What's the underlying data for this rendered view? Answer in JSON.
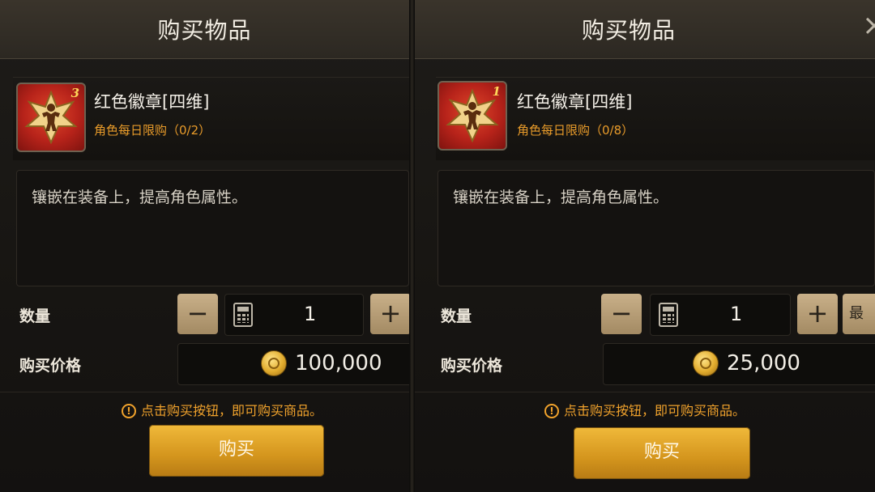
{
  "panels": [
    {
      "title": "购买物品",
      "item_count": "3",
      "item_name": "红色徽章[四维]",
      "item_limit": "角色每日限购（0/2）",
      "description": "镶嵌在装备上，提高角色属性。",
      "quantity_label": "数量",
      "minus_label": "−",
      "plus_label": "+",
      "quantity_value": "1",
      "price_label": "购买价格",
      "price_value": "100,000",
      "hint_icon": "!",
      "hint_text": "点击购买按钮，即可购买商品。",
      "buy_label": "购买"
    },
    {
      "title": "购买物品",
      "close_label": "×",
      "item_count": "1",
      "item_name": "红色徽章[四维]",
      "item_limit": "角色每日限购（0/8）",
      "description": "镶嵌在装备上，提高角色属性。",
      "quantity_label": "数量",
      "minus_label": "−",
      "plus_label": "+",
      "quantity_value": "1",
      "max_label": "最大",
      "price_label": "购买价格",
      "price_value": "25,000",
      "hint_icon": "!",
      "hint_text": "点击购买按钮，即可购买商品。",
      "buy_label": "购买"
    }
  ],
  "icons": {
    "item": "badge-strongman-icon",
    "calculator": "calculator-icon",
    "coin": "gold-coin-icon",
    "hint": "exclamation-circle-icon",
    "close": "close-icon"
  },
  "colors": {
    "accent_gold": "#d4951d",
    "limit_orange": "#e89b2a",
    "hint_orange": "#f0a22c",
    "item_red": "#b7231a"
  }
}
